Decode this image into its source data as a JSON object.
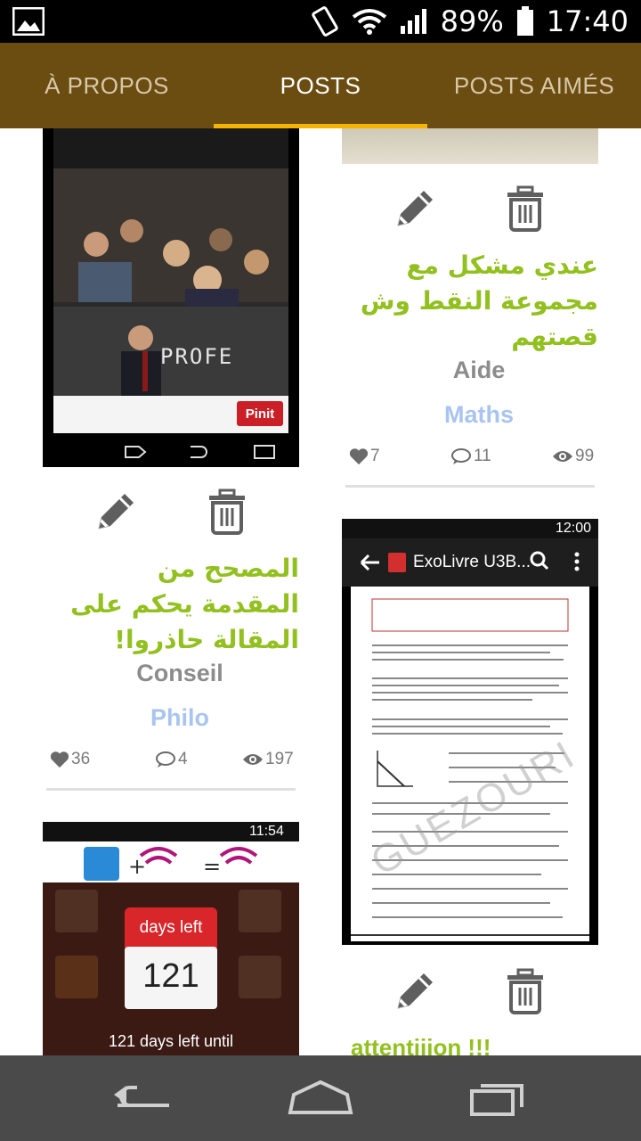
{
  "status_bar": {
    "left_icon": "image-icon",
    "battery_percent": "89%",
    "time": "17:40",
    "icons": [
      "vibrate-icon",
      "wifi-icon",
      "signal-icon",
      "battery-icon"
    ]
  },
  "tabs": [
    {
      "label": "À PROPOS",
      "active": false
    },
    {
      "label": "POSTS",
      "active": true
    },
    {
      "label": "POSTS AIMÉS",
      "active": false
    }
  ],
  "colors": {
    "tabbar": "#6b4d12",
    "indicator": "#f5b400",
    "title_green": "#92c01f",
    "category_gray": "#8c8c8c",
    "subject_blue": "#a8c4f0"
  },
  "posts": [
    {
      "title": "المصحح من المقدمة يحكم على المقالة حاذروا!",
      "category": "Conseil",
      "subject": "Philo",
      "likes": "36",
      "comments": "4",
      "views": "197",
      "image": {
        "overlay_text": "PROFE",
        "button": "Pinit"
      }
    },
    {
      "title": "عندي مشكل مع مجموعة النقط وش قصتهم",
      "category": "Aide",
      "subject": "Maths",
      "likes": "7",
      "comments": "11",
      "views": "99"
    },
    {
      "title": "",
      "image": {
        "status_time": "12:00",
        "app_title": "ExoLivre U3B...",
        "watermark": "GUEZOURI"
      }
    },
    {
      "title": "attentiiion !!!",
      "image": {
        "status_time": "11:54",
        "badge_top": "days left",
        "badge_number": "121",
        "caption": "121 days left until"
      }
    }
  ]
}
